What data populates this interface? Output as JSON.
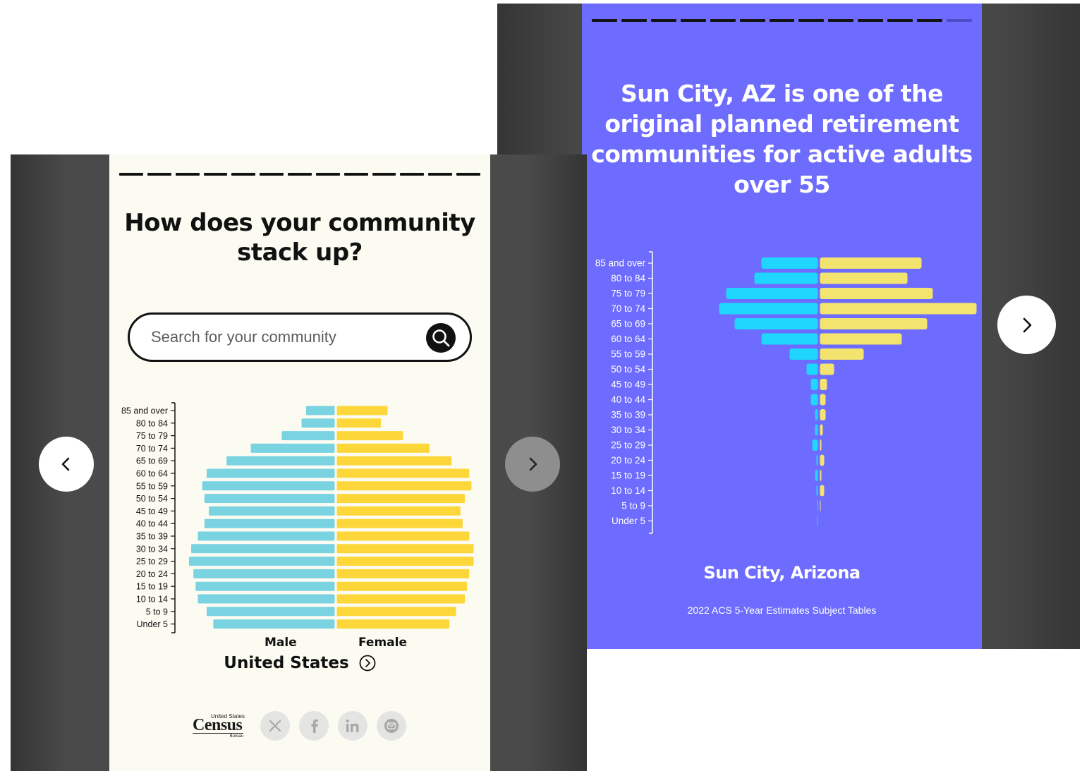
{
  "right_panel": {
    "title": "Sun City, AZ is one of the original planned retirement communities for active adults over 55",
    "place": "Sun City, Arizona",
    "source": "2022 ACS 5-Year Estimates Subject Tables",
    "progress": {
      "segments": 13,
      "completed": 12
    },
    "colors": {
      "background": "#6e6cfe",
      "male": "#1ed6fe",
      "female": "#f2e46e"
    },
    "next_icon": "chevron-right-icon"
  },
  "left_panel": {
    "title": "How does your community stack up?",
    "search": {
      "placeholder": "Search for your community",
      "value": "",
      "icon": "search-icon"
    },
    "legend": {
      "male": "Male",
      "female": "Female"
    },
    "place": "United States",
    "place_icon": "circle-chevron-right-icon",
    "logo": {
      "top": "United States",
      "name": "Census",
      "sub": "Bureau"
    },
    "share_icons": [
      "x-icon",
      "facebook-icon",
      "linkedin-icon",
      "email-icon"
    ],
    "progress": {
      "segments": 13,
      "completed": 13
    },
    "colors": {
      "background": "#fcfbf2",
      "male": "#79d3e1",
      "female": "#fdd73a"
    },
    "prev_icon": "chevron-left-icon",
    "next_icon": "chevron-right-icon"
  },
  "chart_data": [
    {
      "type": "bar",
      "orientation": "horizontal-pyramid",
      "title": "United States",
      "categories": [
        "85 and over",
        "80 to 84",
        "75 to 79",
        "70 to 74",
        "65 to 69",
        "60 to 64",
        "55 to 59",
        "50 to 54",
        "45 to 49",
        "40 to 44",
        "35 to 39",
        "30 to 34",
        "25 to 29",
        "20 to 24",
        "15 to 19",
        "10 to 14",
        "5 to 9",
        "Under 5"
      ],
      "series": [
        {
          "name": "Male",
          "values": [
            1.3,
            1.5,
            2.4,
            3.8,
            4.9,
            5.8,
            6.0,
            5.9,
            5.7,
            5.9,
            6.2,
            6.5,
            6.6,
            6.4,
            6.3,
            6.2,
            5.8,
            5.5
          ]
        },
        {
          "name": "Female",
          "values": [
            2.3,
            2.0,
            3.0,
            4.2,
            5.2,
            6.0,
            6.1,
            5.8,
            5.6,
            5.7,
            6.0,
            6.2,
            6.2,
            6.0,
            5.9,
            5.8,
            5.4,
            5.1
          ]
        }
      ]
    },
    {
      "type": "bar",
      "orientation": "horizontal-pyramid",
      "title": "Sun City, Arizona",
      "categories": [
        "85 and over",
        "80 to 84",
        "75 to 79",
        "70 to 74",
        "65 to 69",
        "60 to 64",
        "55 to 59",
        "50 to 54",
        "45 to 49",
        "40 to 44",
        "35 to 39",
        "30 to 34",
        "25 to 29",
        "20 to 24",
        "15 to 19",
        "10 to 14",
        "5 to 9",
        "Under 5"
      ],
      "series": [
        {
          "name": "Male",
          "values": [
            4.0,
            4.5,
            6.5,
            7.0,
            5.9,
            4.0,
            2.0,
            0.8,
            0.5,
            0.5,
            0.2,
            0.2,
            0.4,
            0.1,
            0.2,
            0.1,
            0.05,
            0.05
          ]
        },
        {
          "name": "Female",
          "values": [
            7.2,
            6.2,
            8.0,
            11.1,
            7.6,
            5.8,
            3.1,
            1.0,
            0.5,
            0.4,
            0.4,
            0.2,
            0.1,
            0.3,
            0.1,
            0.3,
            0.05,
            0.0
          ]
        }
      ]
    }
  ]
}
